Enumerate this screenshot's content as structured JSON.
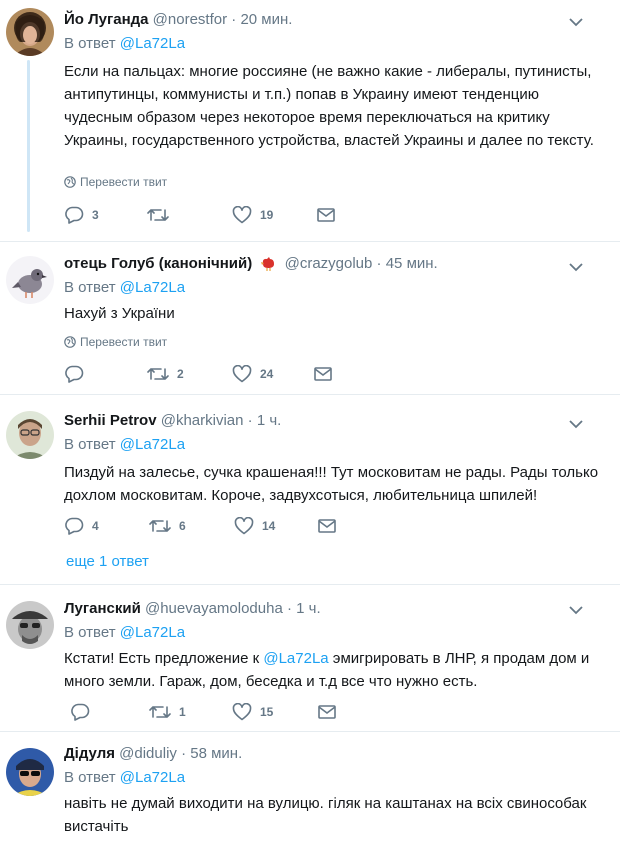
{
  "tweets": [
    {
      "name": "Йо Луганда",
      "handle": "@norestfor",
      "time": "20 мин.",
      "reply_prefix": "В ответ",
      "reply_to": "@La72La",
      "text": "Если на пальцах: многие россияне (не важно какие - либералы, путинисты, антипутинцы, коммунисты и т.п.) попав в Украину имеют тенденцию чудесным образом через некоторое время переключаться на критику Украины, государственного устройства, властей Украины и далее по тексту.",
      "translate": "Перевести твит",
      "replies": "3",
      "retweets": "",
      "likes": "19"
    },
    {
      "name": "отець Голуб (канонічний)",
      "handle": "@crazygolub",
      "time": "45 мин.",
      "reply_prefix": "В ответ",
      "reply_to": "@La72La",
      "text": "Нахуй з України",
      "translate": "Перевести твит",
      "replies": "",
      "retweets": "2",
      "likes": "24"
    },
    {
      "name": "Serhii Petrov",
      "handle": "@kharkivian",
      "time": "1 ч.",
      "reply_prefix": "В ответ",
      "reply_to": "@La72La",
      "text": "Пиздуй на залесье, сучка крашеная!!! Тут московитам не рады. Рады только дохлом московитам. Короче, задвухсотыся, любительница шпилей!",
      "replies": "4",
      "retweets": "6",
      "likes": "14"
    },
    {
      "name": "Луганский",
      "handle": "@huevayamoloduha",
      "time": "1 ч.",
      "reply_prefix": "В ответ",
      "reply_to": "@La72La",
      "text_before": "Кстати! Есть предложение к ",
      "text_mention": "@La72La",
      "text_after": " эмигрировать в ЛНР, я продам дом и много земли. Гараж, дом, беседка и т.д все что нужно есть.",
      "replies": "",
      "retweets": "1",
      "likes": "15"
    },
    {
      "name": "Дідуля",
      "handle": "@diduliy",
      "time": "58 мин.",
      "reply_prefix": "В ответ",
      "reply_to": "@La72La",
      "text": "навіть не думай виходити на вулицю. гіляк на каштанах на всіх свиноcобак вистачіть"
    }
  ],
  "more_replies": "еще 1 ответ",
  "separator": "·",
  "colors": {
    "link": "#1da1f2",
    "secondary": "#657786",
    "thread_line": "#cfe6f6",
    "divider": "#e6ecf0"
  }
}
